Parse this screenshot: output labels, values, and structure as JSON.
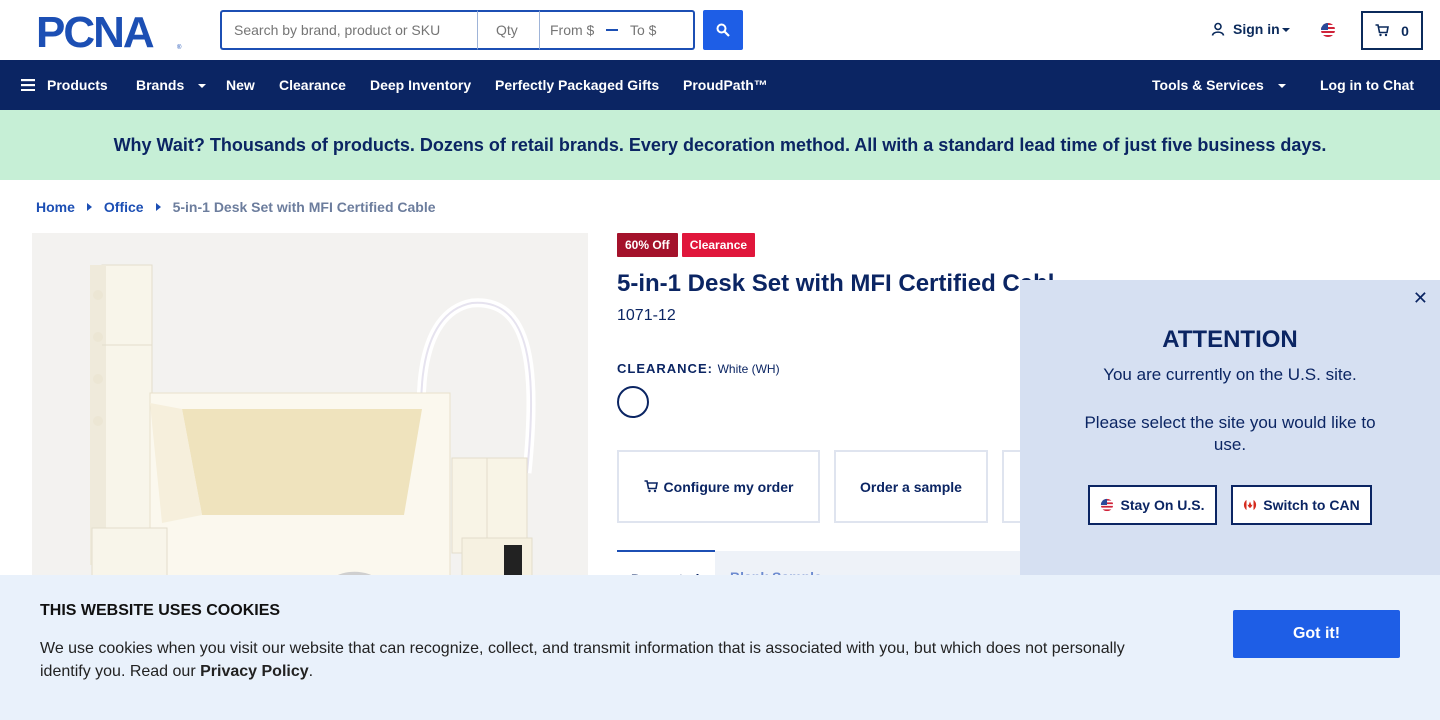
{
  "header": {
    "logo_text": "PCNA",
    "search_placeholder": "Search by brand, product or SKU",
    "qty_placeholder": "Qty",
    "price_from_placeholder": "From $",
    "price_to_placeholder": "To $",
    "signin_label": "Sign in",
    "cart_count": "0"
  },
  "nav": {
    "products": "Products",
    "brands": "Brands",
    "new": "New",
    "clearance": "Clearance",
    "deep_inventory": "Deep Inventory",
    "gifts": "Perfectly Packaged Gifts",
    "proudpath": "ProudPath™",
    "tools": "Tools & Services",
    "chat": "Log in to Chat"
  },
  "promo_text": "Why Wait? Thousands of products. Dozens of retail brands. Every decoration method. All with a standard lead time of just five business days.",
  "breadcrumb": {
    "home": "Home",
    "office": "Office",
    "current": "5-in-1 Desk Set with MFI Certified Cable"
  },
  "product": {
    "badge_off": "60% Off",
    "badge_clearance": "Clearance",
    "title": "5-in-1 Desk Set with MFI Certified Cabl",
    "sku": "1071-12",
    "clearance_label": "CLEARANCE:",
    "color_value": "White (WH)",
    "configure_label": "Configure my order",
    "sample_label": "Order a sample",
    "tab_active": "Decorated",
    "tab_inactive": "Blank Sample"
  },
  "attention": {
    "title": "ATTENTION",
    "line1": "You are currently on the U.S. site.",
    "line2": "Please select the site you would like to use.",
    "stay_label": "Stay On U.S.",
    "switch_label": "Switch to CAN",
    "close_glyph": "✕"
  },
  "cookie": {
    "title": "THIS WEBSITE USES COOKIES",
    "text": "We use cookies when you visit our website that can recognize, collect, and transmit information that is associated with you, but which does not personally identify you. Read our",
    "policy_link": "Privacy Policy",
    "period": ".",
    "button": "Got it!"
  },
  "colors": {
    "navy": "#0b2563",
    "accent_blue": "#1e5ee6",
    "promo_bg": "#c6efd6",
    "badge_dark_red": "#a4122b",
    "badge_red": "#e0163b",
    "modal_bg": "#d6e0f2",
    "cookie_bg": "#e9f1fb"
  }
}
